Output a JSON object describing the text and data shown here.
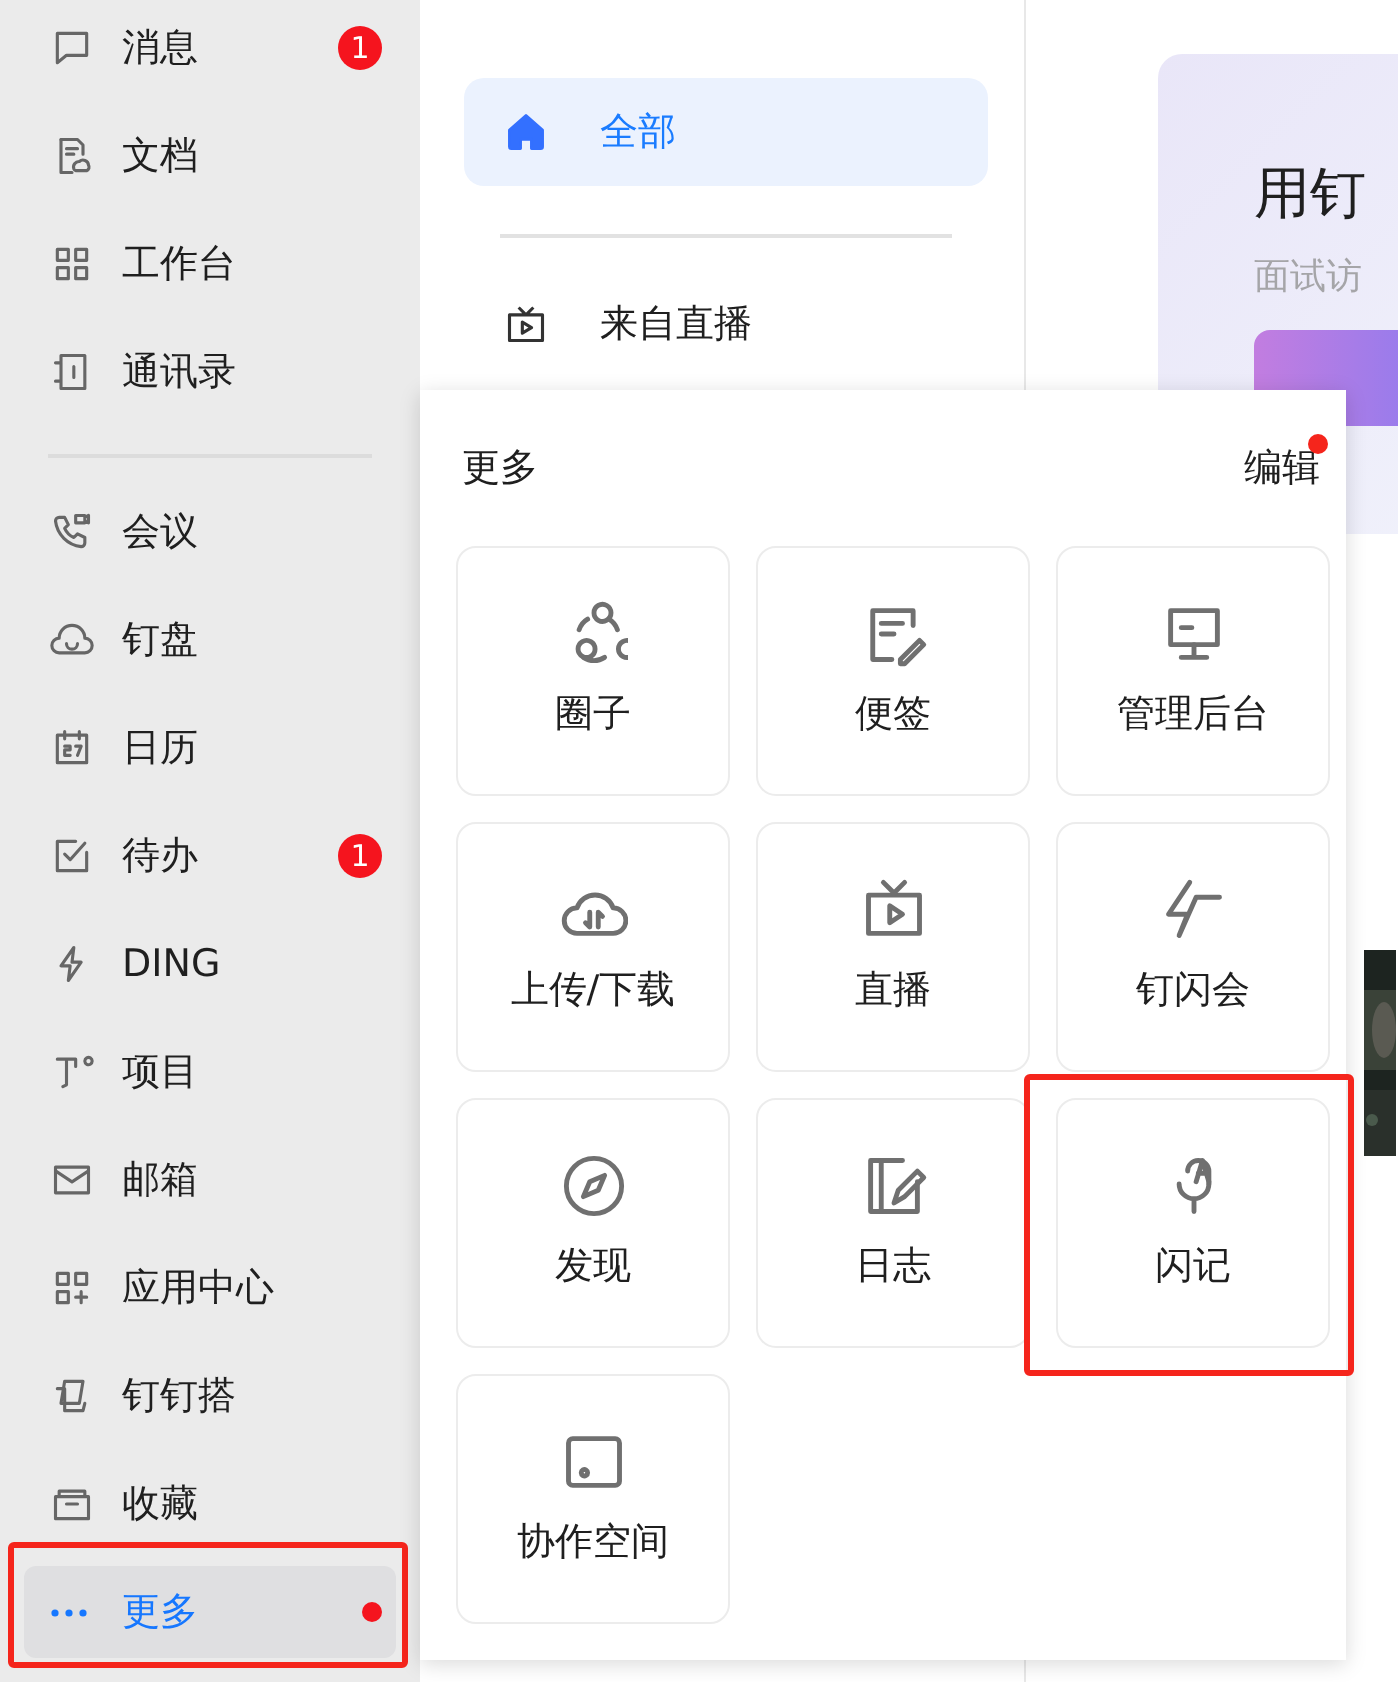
{
  "sidebar": {
    "sections": [
      {
        "items": [
          {
            "label": "消息",
            "badge": "1",
            "dot": false,
            "selected": false,
            "highlighted": false
          },
          {
            "label": "文档",
            "dot": false,
            "selected": false,
            "highlighted": false
          },
          {
            "label": "工作台",
            "dot": false,
            "selected": false,
            "highlighted": false
          },
          {
            "label": "通讯录",
            "dot": false,
            "selected": false,
            "highlighted": false
          }
        ]
      },
      {
        "items": [
          {
            "label": "会议",
            "dot": false,
            "selected": false,
            "highlighted": false
          },
          {
            "label": "钉盘",
            "dot": false,
            "selected": false,
            "highlighted": false
          },
          {
            "label": "日历",
            "dot": false,
            "selected": false,
            "highlighted": false
          },
          {
            "label": "待办",
            "badge": "1",
            "dot": false,
            "selected": false,
            "highlighted": false
          },
          {
            "label": "DING",
            "dot": false,
            "selected": false,
            "highlighted": false
          },
          {
            "label": "项目",
            "dot": false,
            "selected": false,
            "highlighted": false
          },
          {
            "label": "邮箱",
            "dot": false,
            "selected": false,
            "highlighted": false
          },
          {
            "label": "应用中心",
            "dot": false,
            "selected": false,
            "highlighted": false
          },
          {
            "label": "钉钉搭",
            "dot": false,
            "selected": false,
            "highlighted": false
          },
          {
            "label": "收藏",
            "dot": false,
            "selected": false,
            "highlighted": false
          },
          {
            "label": "更多",
            "dot": true,
            "selected": true,
            "highlighted": true
          }
        ]
      }
    ]
  },
  "channels": [
    {
      "label": "全部",
      "selected": true
    },
    {
      "label": "来自直播",
      "selected": false
    }
  ],
  "banner": {
    "title": "用钉",
    "subtitle": "面试访"
  },
  "more_panel": {
    "title": "更多",
    "edit_label": "编辑",
    "edit_dot": true,
    "tiles": [
      {
        "label": "圈子",
        "highlighted": false
      },
      {
        "label": "便签",
        "highlighted": false
      },
      {
        "label": "管理后台",
        "highlighted": false
      },
      {
        "label": "上传/下载",
        "highlighted": false
      },
      {
        "label": "直播",
        "highlighted": false
      },
      {
        "label": "钉闪会",
        "highlighted": false
      },
      {
        "label": "发现",
        "highlighted": false
      },
      {
        "label": "日志",
        "highlighted": false
      },
      {
        "label": "闪记",
        "highlighted": true
      },
      {
        "label": "协作空间",
        "highlighted": false
      }
    ]
  }
}
